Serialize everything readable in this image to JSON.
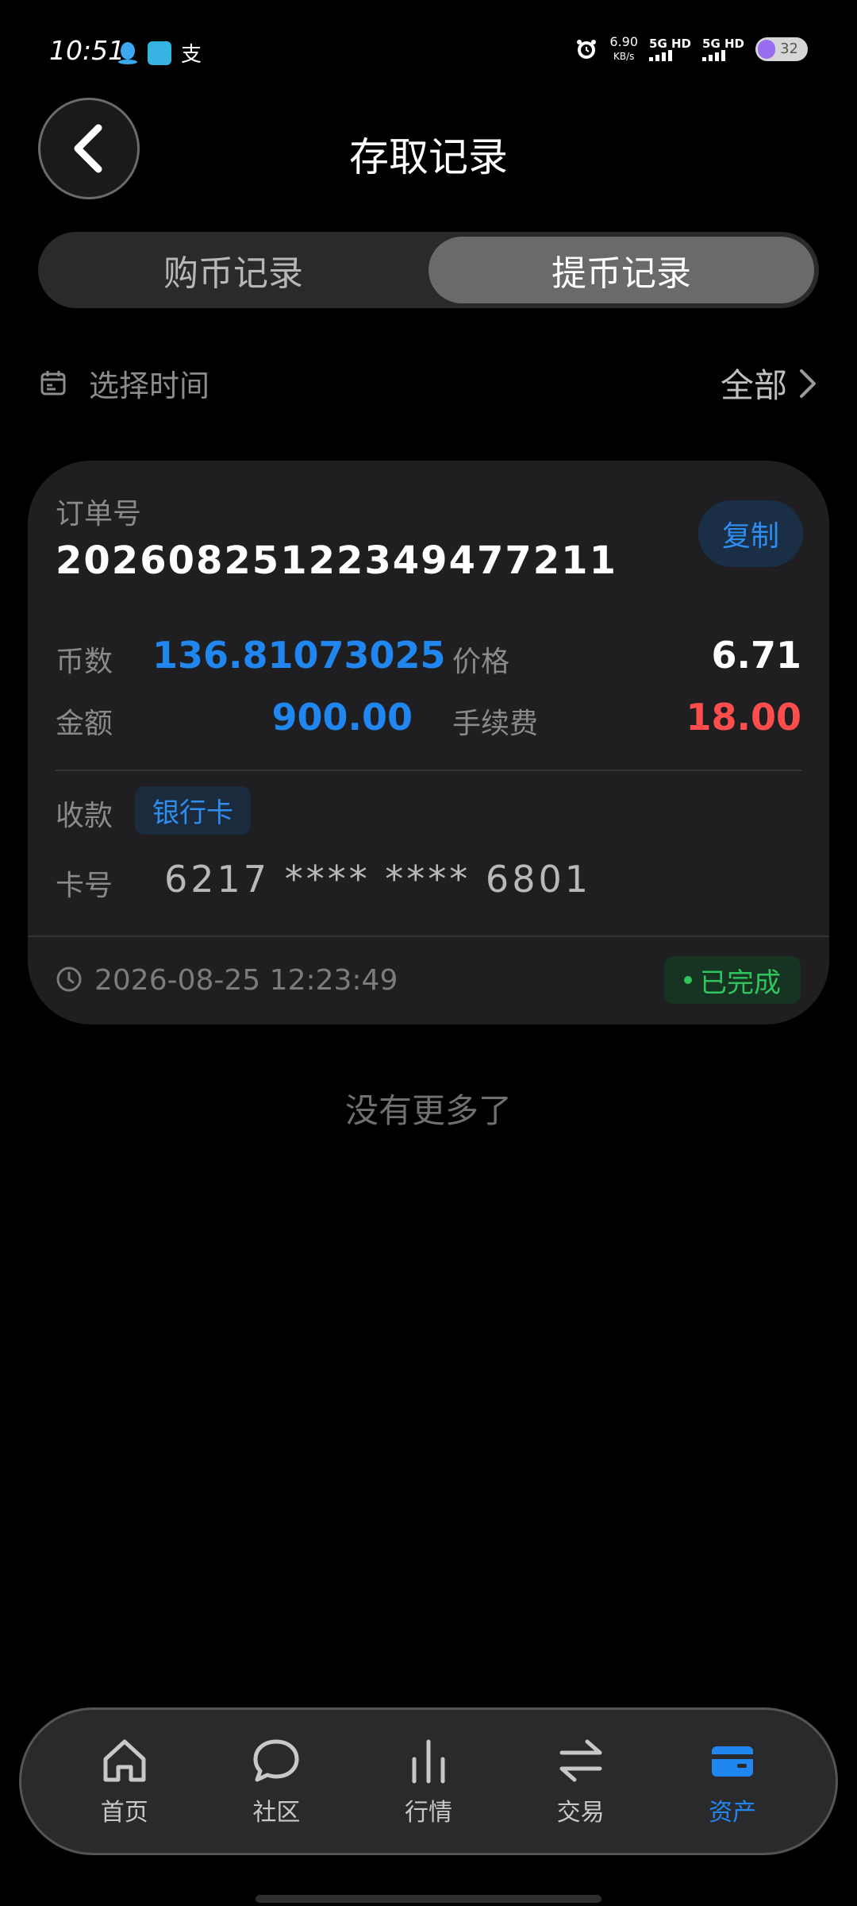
{
  "status_bar": {
    "time": "10:51",
    "speed_value": "6.90",
    "speed_unit": "KB/s",
    "network_1": "5G HD",
    "network_2": "5G HD",
    "battery": "32",
    "notification_icons": [
      "qq-icon",
      "app-icon",
      "alipay-icon"
    ]
  },
  "header": {
    "title": "存取记录"
  },
  "tabs": [
    {
      "label": "购币记录",
      "active": false
    },
    {
      "label": "提币记录",
      "active": true
    }
  ],
  "filter": {
    "date_placeholder": "选择时间",
    "status_filter": "全部"
  },
  "record": {
    "order_label": "订单号",
    "order_number": "20260825122349477211",
    "copy_label": "复制",
    "coins_label": "币数",
    "coins_value": "136.81073025",
    "price_label": "价格",
    "price_value": "6.71",
    "amount_label": "金额",
    "amount_value": "900.00",
    "fee_label": "手续费",
    "fee_value": "18.00",
    "receive_label": "收款",
    "receive_method": "银行卡",
    "card_label": "卡号",
    "card_number": "6217 **** **** 6801",
    "timestamp": "2026-08-25 12:23:49",
    "status": "已完成",
    "colors": {
      "blue": "#2187f0",
      "red": "#ff4d4d",
      "green": "#2fc45c"
    }
  },
  "list_end_text": "没有更多了",
  "bottom_nav": [
    {
      "label": "首页",
      "icon": "home-icon",
      "active": false
    },
    {
      "label": "社区",
      "icon": "chat-icon",
      "active": false
    },
    {
      "label": "行情",
      "icon": "chart-icon",
      "active": false
    },
    {
      "label": "交易",
      "icon": "swap-icon",
      "active": false
    },
    {
      "label": "资产",
      "icon": "wallet-icon",
      "active": true
    }
  ]
}
